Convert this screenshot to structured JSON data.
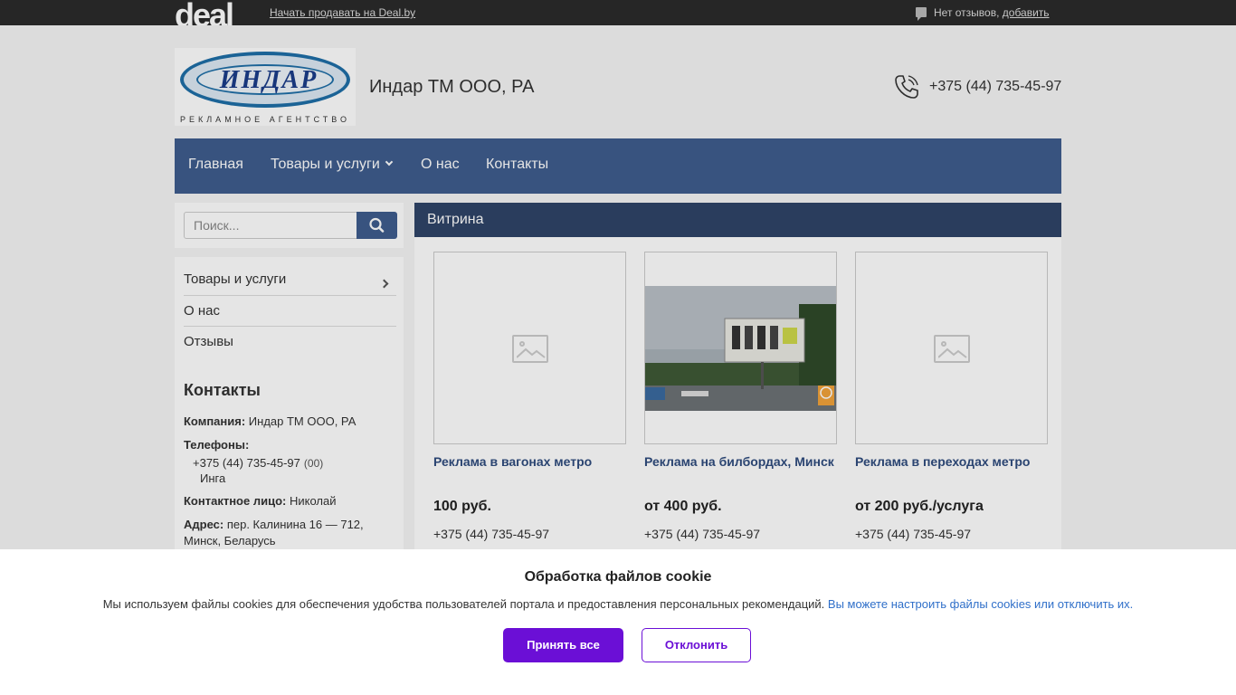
{
  "topbar": {
    "logo": "deal",
    "sell_link": "Начать продавать на Deal.by",
    "reviews_text": "Нет отзывов,",
    "reviews_add": "добавить"
  },
  "header": {
    "logo_text": "ИНДАР",
    "logo_subtext": "РЕКЛАМНОЕ АГЕНТСТВО",
    "company_name": "Индар ТМ ООО, РА",
    "phone": "+375 (44) 735-45-97"
  },
  "nav": {
    "items": [
      "Главная",
      "Товары и услуги",
      "О нас",
      "Контакты"
    ]
  },
  "search": {
    "placeholder": "Поиск..."
  },
  "sidebar": {
    "links": [
      "Товары и услуги",
      "О нас",
      "Отзывы"
    ],
    "contacts_title": "Контакты",
    "company_label": "Компания:",
    "company_value": "Индар ТМ ООО, РА",
    "phones_label": "Телефоны:",
    "phone_value": "+375 (44) 735-45-97",
    "phone_tag": "(00)",
    "phone_person": "Инга",
    "contact_label": "Контактное лицо:",
    "contact_value": "Николай",
    "address_label": "Адрес:",
    "address_line1": "пер. Калинина 16 — 712,",
    "address_line2": "Минск, Беларусь"
  },
  "main": {
    "title": "Витрина",
    "products": [
      {
        "title": "Реклама в вагонах метро",
        "price": "100 руб.",
        "phone": "+375 (44) 735-45-97"
      },
      {
        "title": "Реклама на билбордах, Минск",
        "price": "от 400 руб.",
        "phone": "+375 (44) 735-45-97"
      },
      {
        "title": "Реклама в переходах метро",
        "price": "от 200 руб./услуга",
        "phone": "+375 (44) 735-45-97"
      }
    ]
  },
  "cookie": {
    "title": "Обработка файлов cookie",
    "text": "Мы используем файлы cookies для обеспечения удобства пользователей портала и предоставления персональных рекомендаций.",
    "link": "Вы можете настроить файлы cookies или отключить их.",
    "accept": "Принять все",
    "decline": "Отклонить"
  },
  "colors": {
    "nav": "#3f5d8e",
    "main_header": "#2f4468",
    "product_title": "#2f4c7e",
    "cookie_accent": "#6b0fd6",
    "cookie_link": "#2f6fc9"
  }
}
